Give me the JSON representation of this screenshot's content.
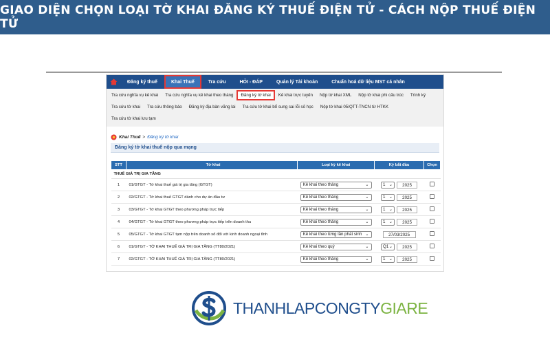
{
  "banner": {
    "title": "GIAO DIỆN CHỌN LOẠI TỜ KHAI ĐĂNG KÝ THUẾ ĐIỆN TỬ - CÁCH NỘP THUẾ ĐIỆN TỬ"
  },
  "topnav": {
    "items": [
      "Đăng ký thuế",
      "Khai Thuế",
      "Tra cứu",
      "HỎI - ĐÁP",
      "Quản lý Tài khoản",
      "Chuẩn hoá dữ liệu MST cá nhân"
    ],
    "active": "Khai Thuế"
  },
  "subnav": {
    "items": [
      "Tra cứu nghĩa vụ kê khai",
      "Tra cứu nghĩa vụ kê khai theo tháng",
      "Đăng ký tờ khai",
      "Kê khai trực tuyến",
      "Nộp tờ khai XML",
      "Nộp tờ khai phi cấu trúc",
      "Trình ký",
      "Tra cứu tờ khai",
      "Tra cứu thông báo",
      "Đăng ký địa bàn vãng lai",
      "Tra cứu tờ khai bổ sung sai lỗi số học",
      "Nộp tờ khai 05/QTT-TNCN từ HTKK",
      "Tra cứu tờ khai lưu tạm"
    ],
    "active": "Đăng ký tờ khai"
  },
  "breadcrumb": {
    "parent": "Khai Thuế",
    "separator": ">",
    "current": "Đăng ký tờ khai"
  },
  "section": {
    "title": "Đăng ký tờ khai thuế nộp qua mạng"
  },
  "table": {
    "headers": {
      "stt": "STT",
      "name": "Tờ khai",
      "type": "Loại kỳ kê khai",
      "period": "Kỳ bắt đầu",
      "pick": "Chọn"
    },
    "group": "THUẾ GIÁ TRỊ GIA TĂNG",
    "rows": [
      {
        "stt": "1",
        "name": "01/GTGT - Tờ khai thuế giá trị gia tăng (GTGT)",
        "type": "Kê khai theo tháng",
        "period_sel": "1",
        "period_val": "2025"
      },
      {
        "stt": "2",
        "name": "02/GTGT - Tờ khai thuế GTGT dành cho dự án đầu tư",
        "type": "Kê khai theo tháng",
        "period_sel": "1",
        "period_val": "2025"
      },
      {
        "stt": "3",
        "name": "03/GTGT - Tờ khai GTGT theo phương pháp trực tiếp",
        "type": "Kê khai theo tháng",
        "period_sel": "1",
        "period_val": "2025"
      },
      {
        "stt": "4",
        "name": "04/GTGT - Tờ khai GTGT theo phương pháp trực tiếp trên doanh thu",
        "type": "Kê khai theo tháng",
        "period_sel": "1",
        "period_val": "2025"
      },
      {
        "stt": "5",
        "name": "05/GTGT - Tờ khai GTGT tạm nộp trên doanh số đối với kinh doanh ngoại tỉnh",
        "type": "Kê khai theo từng lần phát sinh",
        "period_date": "27/03/2025"
      },
      {
        "stt": "6",
        "name": "01/GTGT - TỜ KHAI THUẾ GIÁ TRỊ GIA TĂNG (TT80/2021)",
        "type": "Kê khai theo quý",
        "period_sel": "Q1",
        "period_val": "2025"
      },
      {
        "stt": "7",
        "name": "02/GTGT - TỜ KHAI THUẾ GIÁ TRỊ GIA TĂNG (TT80/2021)",
        "type": "Kê khai theo tháng",
        "period_sel": "1",
        "period_val": "2025"
      }
    ]
  },
  "logo": {
    "text_main": "THANHLAPCONGTY",
    "text_accent": "GIARE",
    "icon": "dollar-globe-icon"
  },
  "colors": {
    "banner": "#2f5d8c",
    "nav": "#1f4e8c",
    "highlight": "#e53935",
    "logo_blue": "#1f4e8c",
    "logo_green": "#7cb342"
  }
}
